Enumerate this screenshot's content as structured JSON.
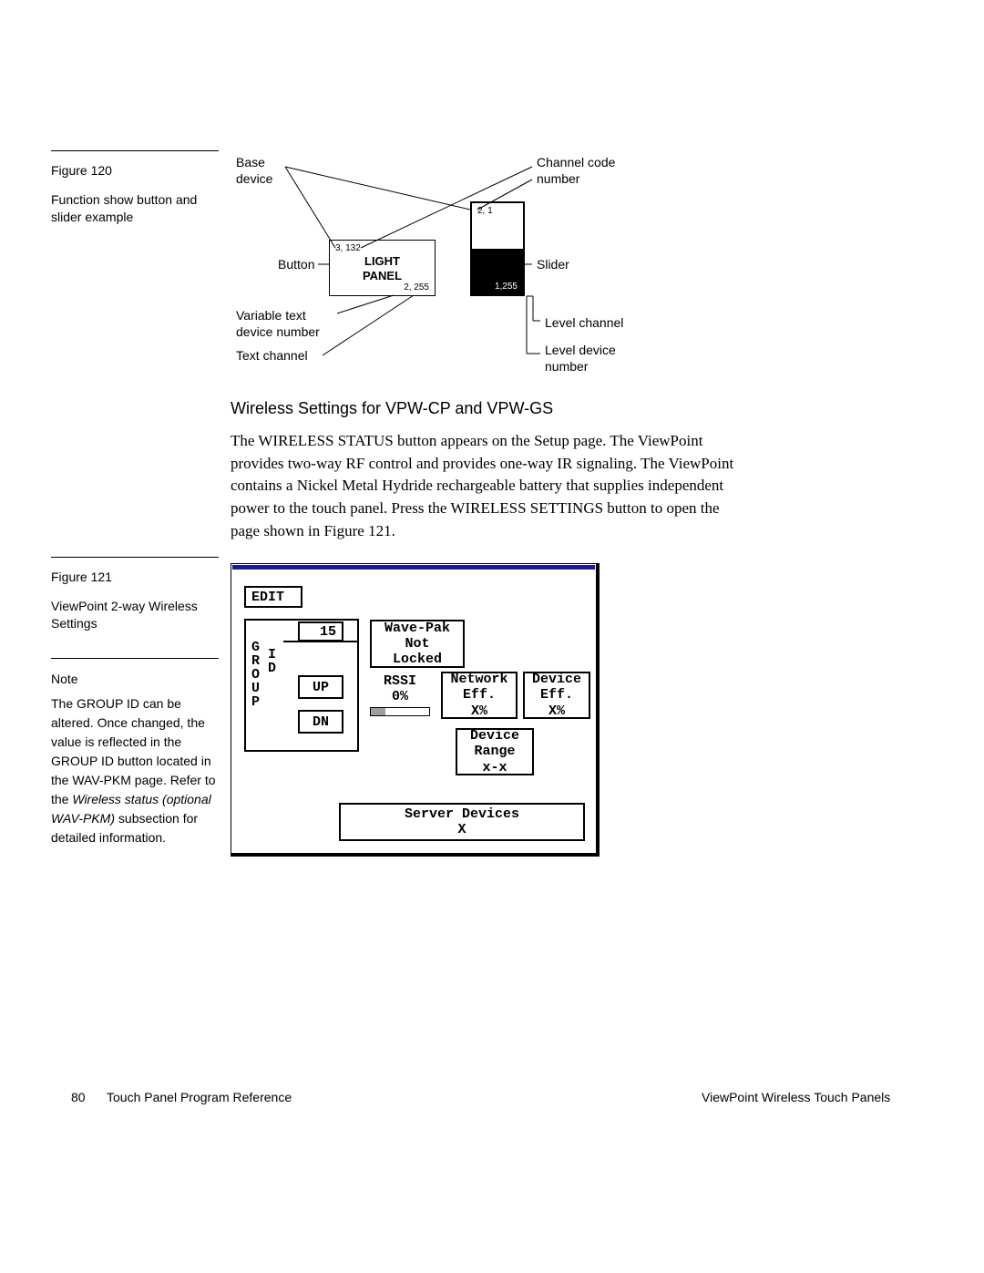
{
  "fig120": {
    "number": "Figure 120",
    "caption": "Function show button and slider example",
    "labels": {
      "base_device": "Base\ndevice",
      "channel_code_number": "Channel code\nnumber",
      "button": "Button",
      "slider": "Slider",
      "variable_text": "Variable text\ndevice number",
      "text_channel": "Text channel",
      "level_channel": "Level channel",
      "level_device_number": "Level device\nnumber"
    },
    "light_panel": {
      "title_line1": "LIGHT",
      "title_line2": "PANEL",
      "code_tl": "3, 132",
      "code_br": "2, 255"
    },
    "slider_codes": {
      "top": "2, 1",
      "bottom": "1,255"
    }
  },
  "heading": "Wireless Settings for VPW-CP and VPW-GS",
  "paragraph": "The WIRELESS STATUS button appears on the Setup page. The ViewPoint provides two-way RF control and provides one-way IR signaling. The ViewPoint contains a Nickel Metal Hydride rechargeable battery that supplies independent power to the touch panel. Press the WIRELESS SETTINGS button to open the page shown in Figure 121.",
  "fig121": {
    "number": "Figure 121",
    "caption": "ViewPoint 2-way Wireless Settings"
  },
  "note": {
    "title": "Note",
    "body_prefix": "The GROUP ID can be altered. Once changed, the value is reflected in the GROUP ID button located in the WAV-PKM page. Refer to the ",
    "body_italic": "Wireless status (optional WAV-PKM)",
    "body_suffix": " subsection for detailed information."
  },
  "ui": {
    "edit": "EDIT",
    "group_vert": "GROUP",
    "id_vert": "ID",
    "group_value": "15",
    "up": "UP",
    "dn": "DN",
    "wavepak": "Wave-Pak\nNot\nLocked",
    "rssi": "RSSI\n0%",
    "net_eff": "Network\nEff.\nX%",
    "dev_eff": "Device\nEff.\nX%",
    "dev_range": "Device\nRange\nx-x",
    "server": "Server Devices\nX"
  },
  "footer": {
    "page": "80",
    "left": "Touch Panel Program Reference",
    "right": "ViewPoint Wireless Touch Panels"
  }
}
